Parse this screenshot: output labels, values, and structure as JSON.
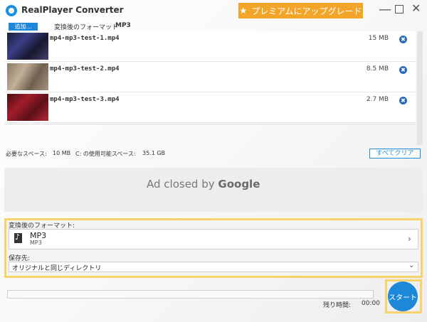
{
  "app": {
    "title": "RealPlayer Converter",
    "premium_label": "プレミアムにアップグレード",
    "premium_icon": "★"
  },
  "window": {
    "minimize": "—",
    "close": "✕"
  },
  "toolbar": {
    "add_label": "追加...",
    "format_label": "変換後のフォーマット",
    "format_value": "MP3"
  },
  "files": [
    {
      "name": "mp4-mp3-test-1.mp4",
      "size": "15 MB",
      "remove": "✖"
    },
    {
      "name": "mp4-mp3-test-2.mp4",
      "size": "8.5 MB",
      "remove": "✖"
    },
    {
      "name": "mp4-mp3-test-3.mp4",
      "size": "2.7 MB",
      "remove": "✖"
    }
  ],
  "storage": {
    "required_label": "必要なスペース:",
    "required_value": "10 MB",
    "available_label": "C: の使用可能スペース:",
    "available_value": "35.1 GB",
    "clear_all": "すべてクリア"
  },
  "ad": {
    "prefix": "Ad closed by ",
    "brand": "Google"
  },
  "settings": {
    "format_caption": "変換後のフォーマット:",
    "format_main": "MP3",
    "format_sub": "MP3",
    "destination_caption": "保存先:",
    "destination_value": "オリジナルと同じディレクトリ"
  },
  "progress": {
    "remaining_label": "残り時間:",
    "remaining_value": "00:00",
    "fraction": 0
  },
  "start": {
    "label": "スタート"
  },
  "colors": {
    "accent": "#1e88d8",
    "premium": "#f3a52a",
    "highlight": "#f7d36b"
  },
  "icons": {
    "chevron_right": "›",
    "chevron_down": "⌄"
  }
}
